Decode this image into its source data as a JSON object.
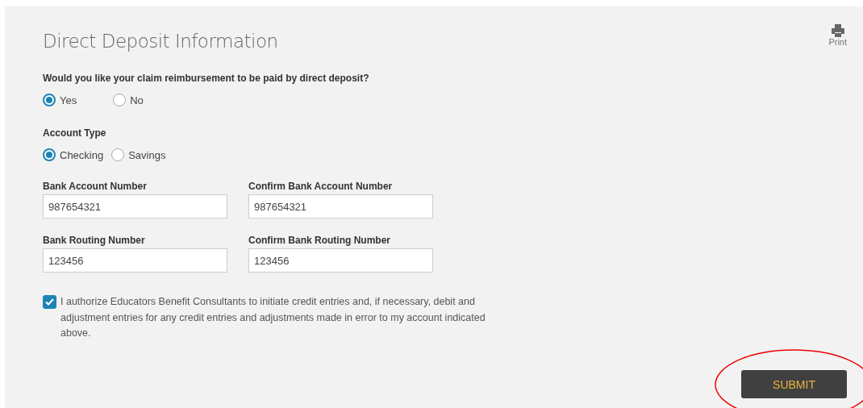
{
  "title": "Direct Deposit Information",
  "print": {
    "label": "Print"
  },
  "question": {
    "label": "Would you like your claim reimbursement to be paid by direct deposit?",
    "options": [
      {
        "label": "Yes",
        "selected": true
      },
      {
        "label": "No",
        "selected": false
      }
    ]
  },
  "account_type": {
    "label": "Account Type",
    "options": [
      {
        "label": "Checking",
        "selected": true
      },
      {
        "label": "Savings",
        "selected": false
      }
    ]
  },
  "fields": [
    [
      {
        "label": "Bank Account Number",
        "value": "987654321"
      },
      {
        "label": "Confirm Bank Account Number",
        "value": "987654321"
      }
    ],
    [
      {
        "label": "Bank Routing Number",
        "value": "123456"
      },
      {
        "label": "Confirm Bank Routing Number",
        "value": "123456"
      }
    ]
  ],
  "authorization": {
    "checked": true,
    "text": "I authorize Educators Benefit Consultants to initiate credit entries and, if necessary, debit and adjustment entries for any credit entries and adjustments made in error to my account indicated above."
  },
  "submit": {
    "label": "SUBMIT",
    "highlighted": true
  }
}
